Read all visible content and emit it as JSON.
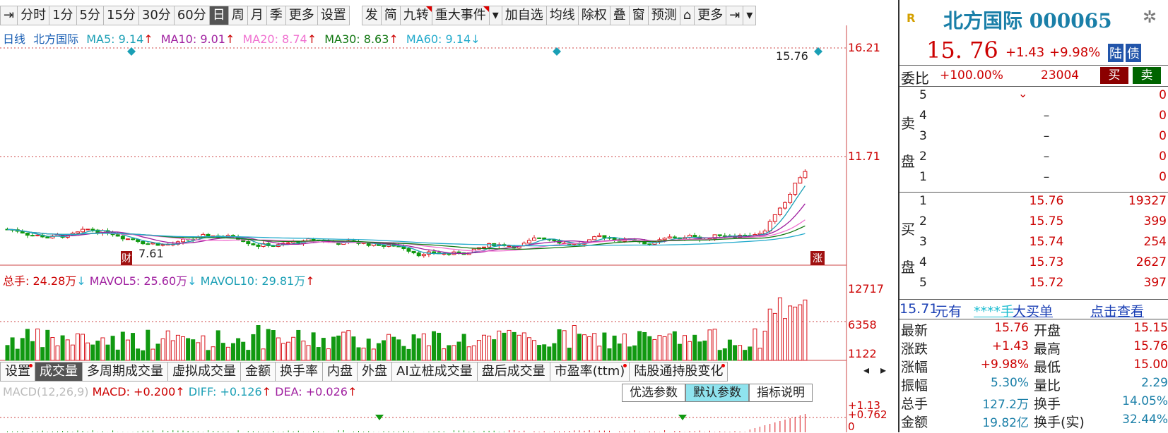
{
  "toolbar": {
    "left_items": [
      "分时",
      "1分",
      "5分",
      "15分",
      "30分",
      "60分",
      "日",
      "周",
      "月",
      "季",
      "更多",
      "设置"
    ],
    "active": "日",
    "right_items": [
      "发",
      "简",
      "九转",
      "重大事件",
      "加自选",
      "均线",
      "除权",
      "叠",
      "窗",
      "预测",
      "更多"
    ]
  },
  "kline": {
    "legend": {
      "period": "日线",
      "name": "北方国际",
      "ma5": "MA5: 9.14",
      "ma10": "MA10: 9.01",
      "ma20": "MA20: 8.74",
      "ma30": "MA30: 8.63",
      "ma60": "MA60: 9.14"
    },
    "axis": [
      "16.21",
      "11.71"
    ],
    "high_label": "15.76",
    "low_label": "7.61",
    "tag_cai": "财",
    "tag_zhangting": "涨"
  },
  "volume": {
    "legend": {
      "total": "总手: 24.28万",
      "mavol5": "MAVOL5: 25.60万",
      "mavol10": "MAVOL10: 29.81万"
    },
    "axis": [
      "12717",
      "6358",
      "1122"
    ]
  },
  "tabs": [
    "设置",
    "成交量",
    "多周期成交量",
    "虚拟成交量",
    "金额",
    "换手率",
    "内盘",
    "外盘",
    "AI立桩成交量",
    "盘后成交量",
    "市盈率(ttm)",
    "陆股通持股变化"
  ],
  "tabs_active": "成交量",
  "macd": {
    "legend": {
      "name": "MACD(12,26,9)",
      "macd": "MACD: +0.200",
      "diff": "DIFF: +0.126",
      "dea": "DEA: +0.026"
    },
    "buttons": [
      "优选参数",
      "默认参数",
      "指标说明"
    ],
    "axis": [
      "+1.13",
      "+0.762",
      "0"
    ]
  },
  "right": {
    "logo": "R",
    "stock_name": "北方国际 000065",
    "price": "15. 76",
    "change": "+1.43",
    "change_pct": "+9.98%",
    "badge1": "陆",
    "badge2": "债",
    "webi_label": "委比",
    "webi_value": "+100.00%",
    "webi_diff": "23004",
    "buy_btn": "买",
    "sell_btn": "卖",
    "sell_label": [
      "卖",
      "盘"
    ],
    "buy_label": [
      "买",
      "盘"
    ],
    "sell_rows": [
      {
        "n": "5",
        "p": "",
        "v": "0"
      },
      {
        "n": "4",
        "p": "–",
        "v": "0"
      },
      {
        "n": "3",
        "p": "–",
        "v": "0"
      },
      {
        "n": "2",
        "p": "–",
        "v": "0"
      },
      {
        "n": "1",
        "p": "–",
        "v": "0"
      }
    ],
    "buy_rows": [
      {
        "n": "1",
        "p": "15.76",
        "v": "19327"
      },
      {
        "n": "2",
        "p": "15.75",
        "v": "399"
      },
      {
        "n": "3",
        "p": "15.74",
        "v": "254"
      },
      {
        "n": "4",
        "p": "15.73",
        "v": "2627"
      },
      {
        "n": "5",
        "p": "15.72",
        "v": "397"
      }
    ],
    "big_order": {
      "price": "15.71",
      "a": "元有",
      "b": "****手",
      "c": "大买单",
      "d": "点击查看"
    },
    "quotes": [
      {
        "k1": "最新",
        "v1": "15.76",
        "k2": "开盘",
        "v2": "15.15"
      },
      {
        "k1": "涨跌",
        "v1": "+1.43",
        "k2": "最高",
        "v2": "15.76"
      },
      {
        "k1": "涨幅",
        "v1": "+9.98%",
        "k2": "最低",
        "v2": "15.00"
      },
      {
        "k1": "振幅",
        "v1": "5.30%",
        "k2": "量比",
        "v2": "2.29"
      },
      {
        "k1": "总手",
        "v1": "127.2万",
        "k2": "换手",
        "v2": "14.05%"
      },
      {
        "k1": "金额",
        "v1": "19.82亿",
        "k2": "换手(实)",
        "v2": "32.44%"
      }
    ]
  },
  "colors": {
    "up": "#d9141c",
    "down": "#119911",
    "ma5": "#1a9fb5",
    "ma10": "#a020a0",
    "ma20": "#f070d0",
    "ma30": "#117711",
    "ma60": "#22aacc"
  }
}
